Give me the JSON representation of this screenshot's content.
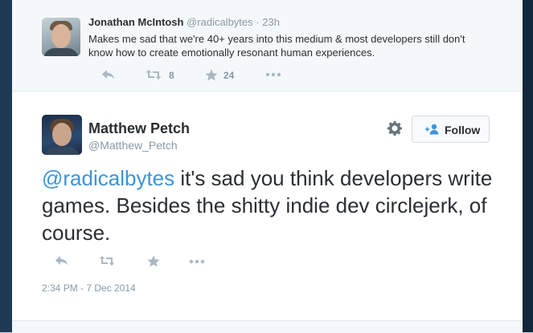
{
  "parent_tweet": {
    "name": "Jonathan McIntosh",
    "handle": "@radicalbytes",
    "separator": "·",
    "time": "23h",
    "text": "Makes me sad that we're 40+ years into this medium & most developers still don't know how to create emotionally resonant human experiences.",
    "retweet_count": "8",
    "favorite_count": "24",
    "icons": [
      "reply-icon",
      "retweet-icon",
      "favorite-icon",
      "more-icon"
    ]
  },
  "tweet": {
    "name": "Matthew Petch",
    "handle": "@Matthew_Petch",
    "mention": "@radicalbytes",
    "text": " it's sad you think developers write games. Besides the shitty indie dev circlejerk, of course.",
    "timestamp": "2:34 PM - 7 Dec 2014",
    "follow_label": "Follow",
    "icons": [
      "reply-icon",
      "retweet-icon",
      "favorite-icon",
      "more-icon",
      "gear-icon",
      "follow-icon"
    ]
  },
  "colors": {
    "link": "#3b94d9",
    "text": "#292f33",
    "muted": "#8899a6",
    "action_icon": "#aab8c2",
    "background": "#f5f8fa"
  }
}
